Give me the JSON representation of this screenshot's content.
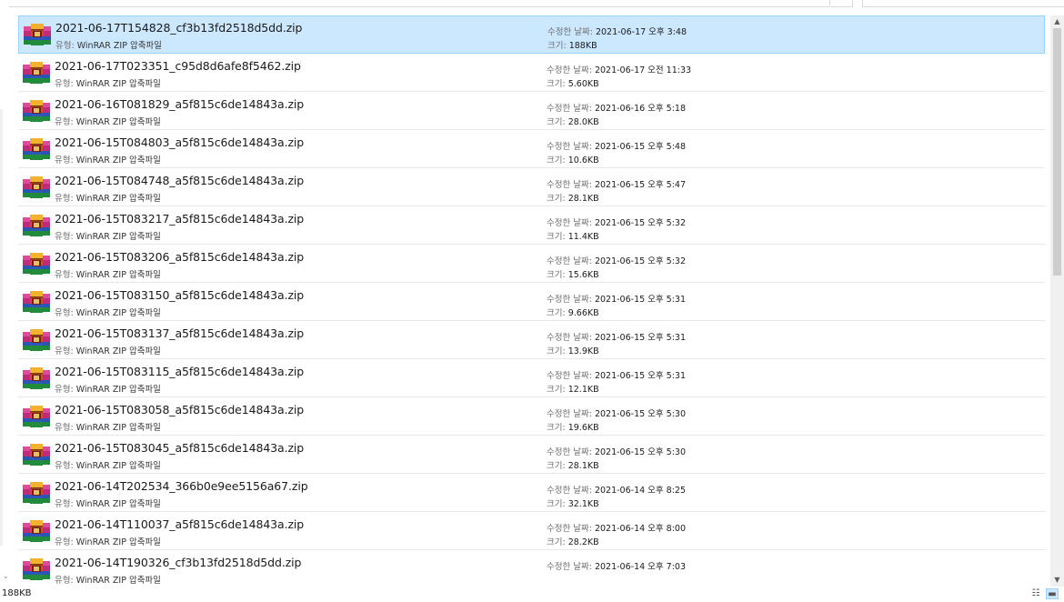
{
  "labels": {
    "type": "유형:",
    "modified": "수정한 날짜:",
    "size": "크기:"
  },
  "icon": "winrar-archive-icon",
  "files": [
    {
      "name": "2021-06-17T154828_cf3b13fd2518d5dd.zip",
      "type": "WinRAR ZIP 압축파일",
      "date": "2021-06-17 오후 3:48",
      "size": "188KB",
      "selected": true
    },
    {
      "name": "2021-06-17T023351_c95d8d6afe8f5462.zip",
      "type": "WinRAR ZIP 압축파일",
      "date": "2021-06-17 오전 11:33",
      "size": "5.60KB"
    },
    {
      "name": "2021-06-16T081829_a5f815c6de14843a.zip",
      "type": "WinRAR ZIP 압축파일",
      "date": "2021-06-16 오후 5:18",
      "size": "28.0KB"
    },
    {
      "name": "2021-06-15T084803_a5f815c6de14843a.zip",
      "type": "WinRAR ZIP 압축파일",
      "date": "2021-06-15 오후 5:48",
      "size": "10.6KB"
    },
    {
      "name": "2021-06-15T084748_a5f815c6de14843a.zip",
      "type": "WinRAR ZIP 압축파일",
      "date": "2021-06-15 오후 5:47",
      "size": "28.1KB"
    },
    {
      "name": "2021-06-15T083217_a5f815c6de14843a.zip",
      "type": "WinRAR ZIP 압축파일",
      "date": "2021-06-15 오후 5:32",
      "size": "11.4KB"
    },
    {
      "name": "2021-06-15T083206_a5f815c6de14843a.zip",
      "type": "WinRAR ZIP 압축파일",
      "date": "2021-06-15 오후 5:32",
      "size": "15.6KB"
    },
    {
      "name": "2021-06-15T083150_a5f815c6de14843a.zip",
      "type": "WinRAR ZIP 압축파일",
      "date": "2021-06-15 오후 5:31",
      "size": "9.66KB"
    },
    {
      "name": "2021-06-15T083137_a5f815c6de14843a.zip",
      "type": "WinRAR ZIP 압축파일",
      "date": "2021-06-15 오후 5:31",
      "size": "13.9KB"
    },
    {
      "name": "2021-06-15T083115_a5f815c6de14843a.zip",
      "type": "WinRAR ZIP 압축파일",
      "date": "2021-06-15 오후 5:31",
      "size": "12.1KB"
    },
    {
      "name": "2021-06-15T083058_a5f815c6de14843a.zip",
      "type": "WinRAR ZIP 압축파일",
      "date": "2021-06-15 오후 5:30",
      "size": "19.6KB"
    },
    {
      "name": "2021-06-15T083045_a5f815c6de14843a.zip",
      "type": "WinRAR ZIP 압축파일",
      "date": "2021-06-15 오후 5:30",
      "size": "28.1KB"
    },
    {
      "name": "2021-06-14T202534_366b0e9ee5156a67.zip",
      "type": "WinRAR ZIP 압축파일",
      "date": "2021-06-14 오후 8:25",
      "size": "32.1KB"
    },
    {
      "name": "2021-06-14T110037_a5f815c6de14843a.zip",
      "type": "WinRAR ZIP 압축파일",
      "date": "2021-06-14 오후 8:00",
      "size": "28.2KB"
    },
    {
      "name": "2021-06-14T190326_cf3b13fd2518d5dd.zip",
      "type": "WinRAR ZIP 압축파일",
      "date": "2021-06-14 오후 7:03",
      "size": ""
    }
  ],
  "status": {
    "selection_size": "188KB"
  },
  "colors": {
    "selection_bg": "#cce8ff",
    "selection_border": "#99d1ff"
  }
}
